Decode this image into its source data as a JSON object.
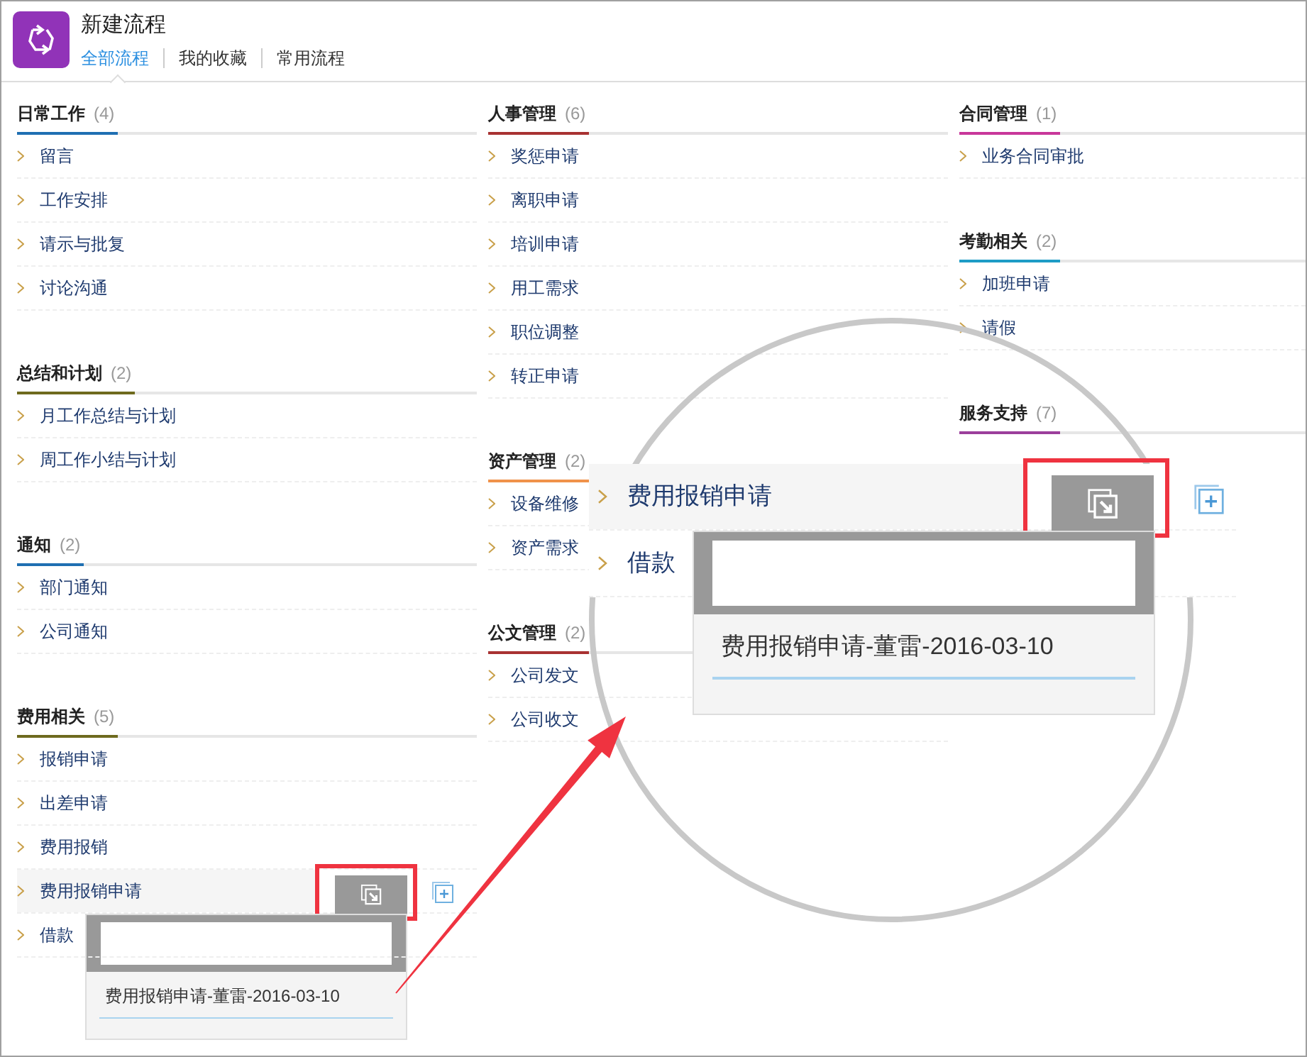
{
  "header": {
    "title": "新建流程",
    "tabs": [
      {
        "label": "全部流程",
        "selected": true
      },
      {
        "label": "我的收藏",
        "selected": false
      },
      {
        "label": "常用流程",
        "selected": false
      }
    ]
  },
  "columns": [
    {
      "sections": [
        {
          "title": "日常工作",
          "count": "(4)",
          "color": "#1f6fb2",
          "items": [
            {
              "label": "留言"
            },
            {
              "label": "工作安排"
            },
            {
              "label": "请示与批复"
            },
            {
              "label": "讨论沟通"
            }
          ]
        },
        {
          "title": "总结和计划",
          "count": "(2)",
          "color": "#6e6a1e",
          "items": [
            {
              "label": "月工作总结与计划"
            },
            {
              "label": "周工作小结与计划"
            }
          ]
        },
        {
          "title": "通知",
          "count": "(2)",
          "color": "#1f6fb2",
          "items": [
            {
              "label": "部门通知"
            },
            {
              "label": "公司通知"
            }
          ]
        },
        {
          "title": "费用相关",
          "count": "(5)",
          "color": "#6e6a1e",
          "items": [
            {
              "label": "报销申请",
              "highlighted": false
            },
            {
              "label": "出差申请",
              "highlighted": false
            },
            {
              "label": "费用报销",
              "highlighted": false
            },
            {
              "label": "费用报销申请",
              "highlighted": true
            },
            {
              "label": "借款",
              "highlighted": false
            }
          ]
        }
      ]
    },
    {
      "sections": [
        {
          "title": "人事管理",
          "count": "(6)",
          "color": "#a83232",
          "items": [
            {
              "label": "奖惩申请"
            },
            {
              "label": "离职申请"
            },
            {
              "label": "培训申请"
            },
            {
              "label": "用工需求"
            },
            {
              "label": "职位调整"
            },
            {
              "label": "转正申请"
            }
          ]
        },
        {
          "title": "资产管理",
          "count": "(2)",
          "color": "#f0924a",
          "items": [
            {
              "label": "设备维修"
            },
            {
              "label": "资产需求"
            }
          ]
        },
        {
          "title": "公文管理",
          "count": "(2)",
          "color": "#a83232",
          "items": [
            {
              "label": "公司发文"
            },
            {
              "label": "公司收文"
            }
          ]
        }
      ]
    },
    {
      "sections": [
        {
          "title": "合同管理",
          "count": "(1)",
          "color": "#c8379a",
          "items": [
            {
              "label": "业务合同审批"
            }
          ]
        },
        {
          "title": "考勤相关",
          "count": "(2)",
          "color": "#1e9cc6",
          "items": [
            {
              "label": "加班申请"
            },
            {
              "label": "请假"
            }
          ]
        },
        {
          "title": "服务支持",
          "count": "(7)",
          "color": "#9b3f9b"
        }
      ]
    }
  ],
  "hover_popup": {
    "text": "费用报销申请-董雷-2016-03-10"
  },
  "magnifier": {
    "rows": [
      {
        "label": "费用报销申请",
        "highlighted": true
      },
      {
        "label": "借款",
        "highlighted": false
      }
    ],
    "popup_text": "费用报销申请-董雷-2016-03-10"
  }
}
